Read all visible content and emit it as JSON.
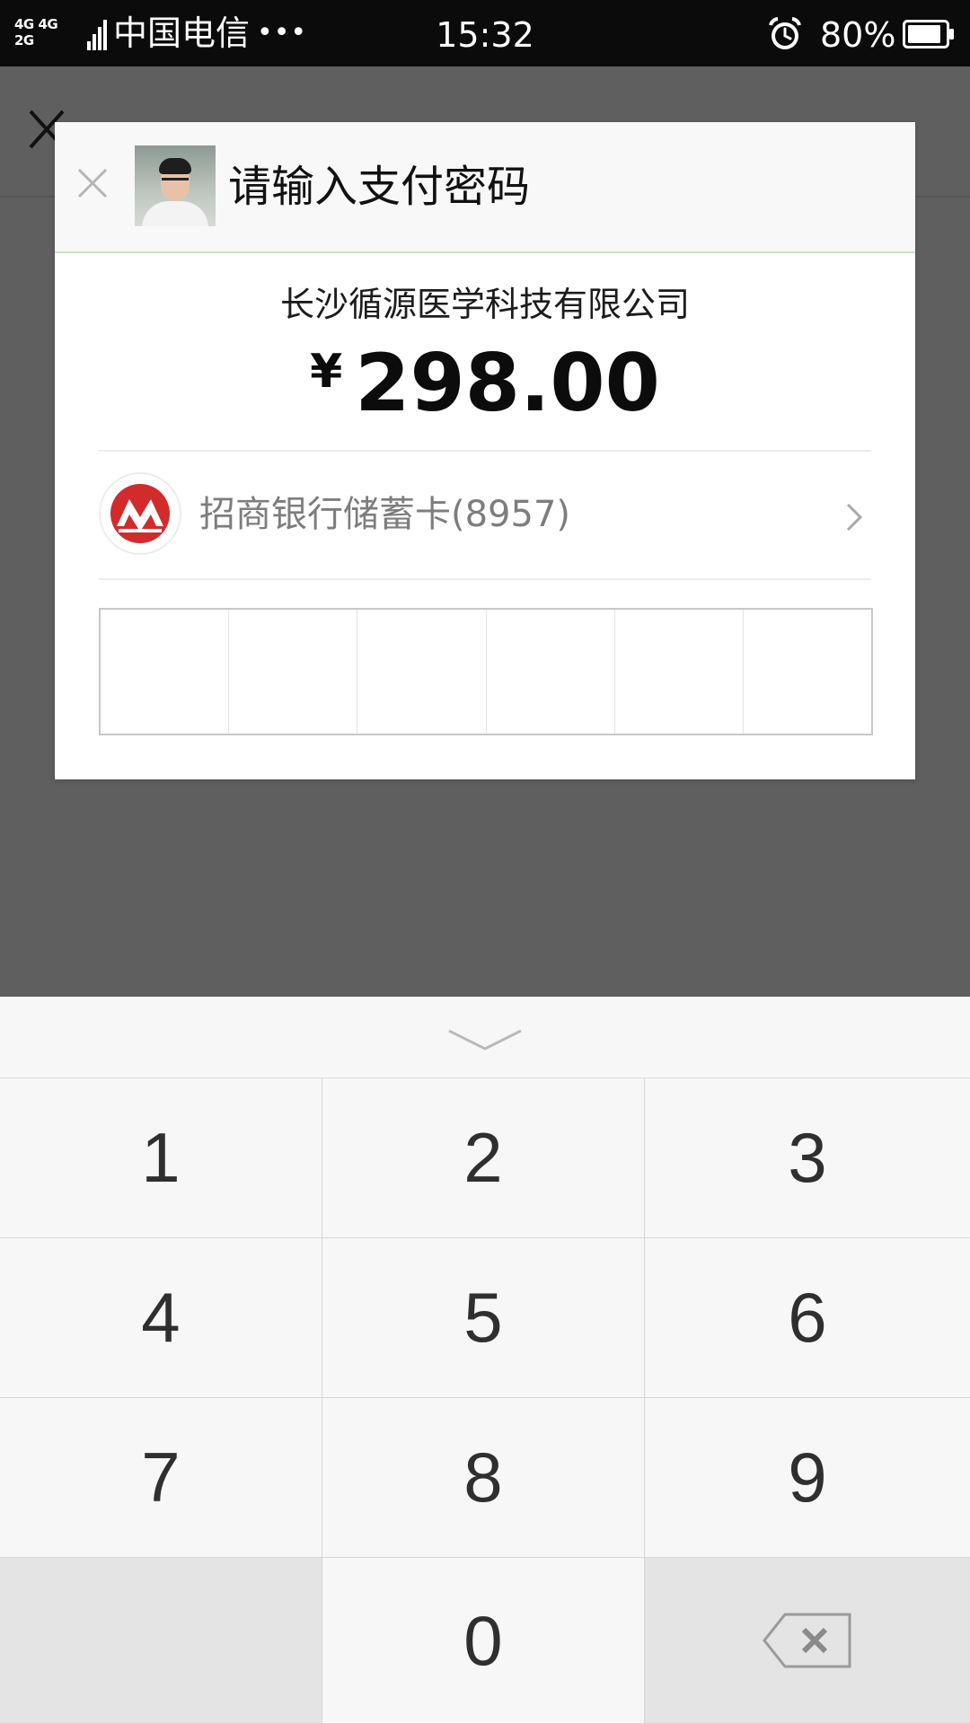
{
  "status_bar": {
    "net_top": "4G 4G",
    "net_bottom": "2G",
    "carrier": "中国电信",
    "dots": "•••",
    "time": "15:32",
    "battery": "80%"
  },
  "dialog": {
    "title": "请输入支付密码",
    "merchant": "长沙循源医学科技有限公司",
    "currency": "¥",
    "amount": "298.00",
    "bank_card": "招商银行储蓄卡(8957)",
    "password_cells": 6,
    "password_entered": 0
  },
  "keypad": {
    "keys": [
      "1",
      "2",
      "3",
      "4",
      "5",
      "6",
      "7",
      "8",
      "9",
      "",
      "0",
      "backspace"
    ]
  },
  "colors": {
    "overlay": "#5f5f5f",
    "bank_red": "#d12b2b",
    "header_divider": "#c7e3c6"
  },
  "icons": [
    "alarm-icon",
    "battery-icon",
    "back-close-icon",
    "close-icon",
    "cmb-logo-icon",
    "chevron-right-icon",
    "chevron-down-icon",
    "backspace-icon"
  ]
}
